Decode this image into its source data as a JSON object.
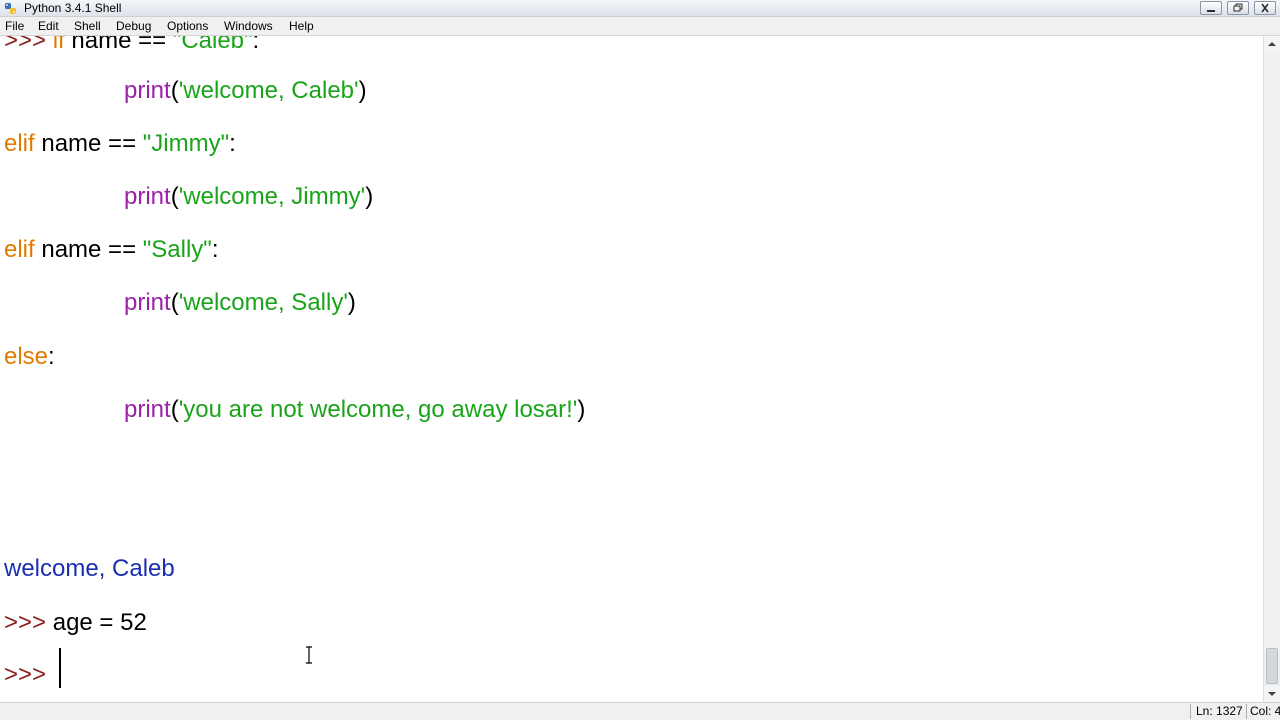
{
  "window": {
    "title": "Python 3.4.1 Shell"
  },
  "menu": {
    "file": "File",
    "edit": "Edit",
    "shell": "Shell",
    "debug": "Debug",
    "options": "Options",
    "windows": "Windows",
    "help": "Help"
  },
  "code": {
    "line0": {
      "prompt": ">>> ",
      "kw": "if",
      "text": " name == ",
      "str": "\"Caleb\"",
      "end": ":"
    },
    "line1": {
      "bi": "print",
      "open": "(",
      "str": "'welcome, Caleb'",
      "close": ")"
    },
    "line2": {
      "kw": "elif",
      "text": " name == ",
      "str": "\"Jimmy\"",
      "end": ":"
    },
    "line3": {
      "bi": "print",
      "open": "(",
      "str": "'welcome, Jimmy'",
      "close": ")"
    },
    "line4": {
      "kw": "elif",
      "text": " name == ",
      "str": "\"Sally\"",
      "end": ":"
    },
    "line5": {
      "bi": "print",
      "open": "(",
      "str": "'welcome, Sally'",
      "close": ")"
    },
    "line6": {
      "kw": "else",
      "end": ":"
    },
    "line7": {
      "bi": "print",
      "open": "(",
      "str": "'you are not welcome, go away losar!'",
      "close": ")"
    },
    "output": "welcome, Caleb",
    "line9": {
      "prompt": ">>> ",
      "text": "age = 52"
    },
    "line10": {
      "prompt": ">>> "
    }
  },
  "status": {
    "ln": "Ln: 1327",
    "col": "Col: 4"
  },
  "colors": {
    "keyword": "#e07b00",
    "builtin": "#9b22a8",
    "string": "#1aa41a",
    "prompt": "#8b1c1c",
    "output": "#1a2fb0"
  },
  "icons": {
    "app": "python-icon",
    "minimize": "minimize-icon",
    "maximize": "restore-icon",
    "close": "close-icon",
    "scroll_up": "arrow-up-icon",
    "scroll_down": "arrow-down-icon",
    "cursor": "text-cursor-icon"
  }
}
